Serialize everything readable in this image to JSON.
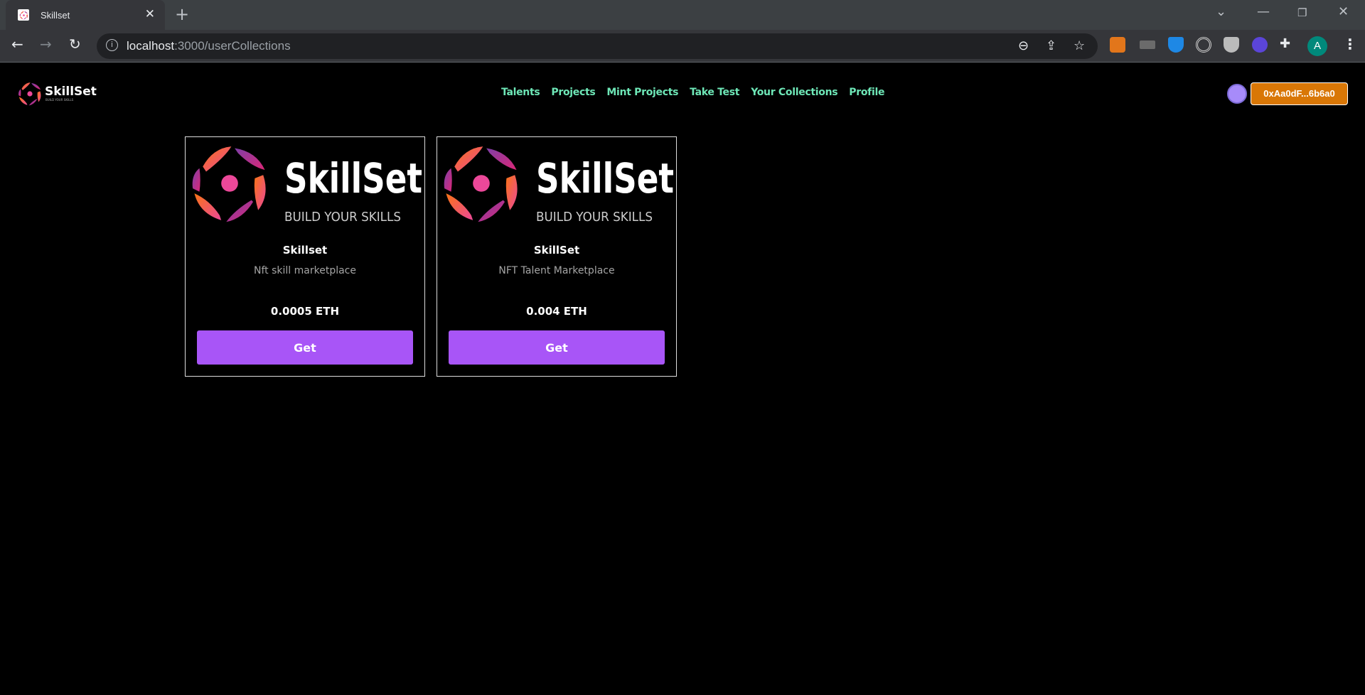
{
  "browser": {
    "tab_title": "Skillset",
    "url_host": "localhost",
    "url_path": ":3000/userCollections",
    "profile_initial": "A"
  },
  "site": {
    "logo_name": "SkillSet",
    "logo_tagline": "BUILD YOUR SKILLS",
    "nav": [
      "Talents",
      "Projects",
      "Mint Projects",
      "Take Test",
      "Your Collections",
      "Profile"
    ],
    "wallet_address": "0xAa0dF...6b6a0",
    "accent": "#6ee7b7",
    "button_color": "#a855f7",
    "wallet_color": "#d97706"
  },
  "cards": [
    {
      "logo_name": "SkillSet",
      "logo_tagline": "BUILD YOUR SKILLS",
      "title": "Skillset",
      "description": "Nft skill marketplace",
      "price": "0.0005 ETH",
      "button": "Get"
    },
    {
      "logo_name": "SkillSet",
      "logo_tagline": "BUILD YOUR SKILLS",
      "title": "SkillSet",
      "description": "NFT Talent Marketplace",
      "price": "0.004 ETH",
      "button": "Get"
    }
  ]
}
